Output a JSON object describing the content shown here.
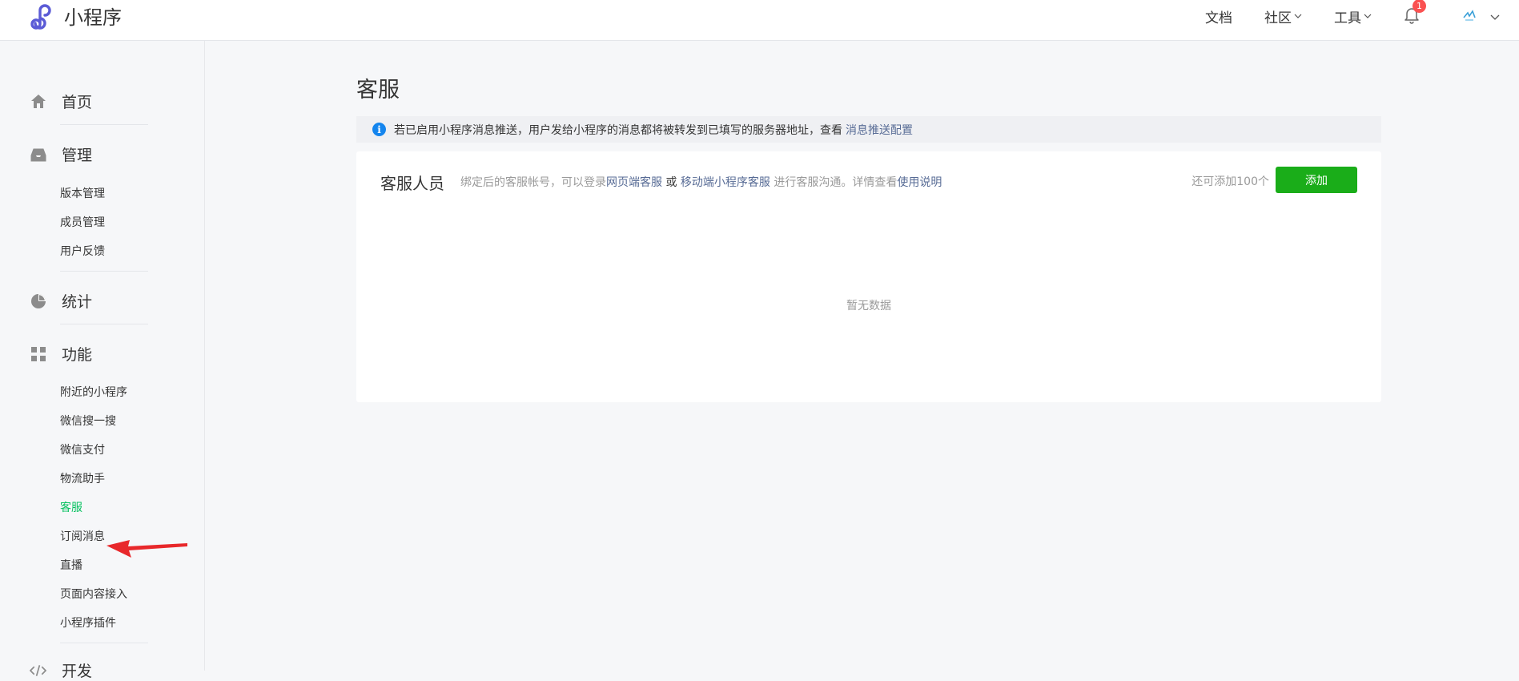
{
  "topbar": {
    "brand_name": "小程序",
    "nav": {
      "docs": "文档",
      "community": "社区",
      "tools": "工具"
    },
    "notification_count": "1",
    "brand_color": "#5a5ae6"
  },
  "sidebar": {
    "home": "首页",
    "manage": {
      "label": "管理",
      "items": [
        "版本管理",
        "成员管理",
        "用户反馈"
      ]
    },
    "stats": "统计",
    "features": {
      "label": "功能",
      "items": [
        "附近的小程序",
        "微信搜一搜",
        "微信支付",
        "物流助手",
        "客服",
        "订阅消息",
        "直播",
        "页面内容接入",
        "小程序插件"
      ]
    },
    "dev": "开发",
    "active_item": "客服",
    "active_color": "#07c160"
  },
  "main": {
    "title": "客服",
    "notice": {
      "text": "若已启用小程序消息推送，用户发给小程序的消息都将被转发到已填写的服务器地址，查看",
      "link": "消息推送配置"
    },
    "card": {
      "title": "客服人员",
      "desc_prefix": "绑定后的客服帐号，可以登录",
      "link_web": "网页端客服",
      "or": "或",
      "link_mobile": "移动端小程序客服",
      "desc_middle": "进行客服沟通。详情查看",
      "link_help": "使用说明",
      "quota": "还可添加100个",
      "add_button": "添加",
      "empty": "暂无数据"
    }
  }
}
